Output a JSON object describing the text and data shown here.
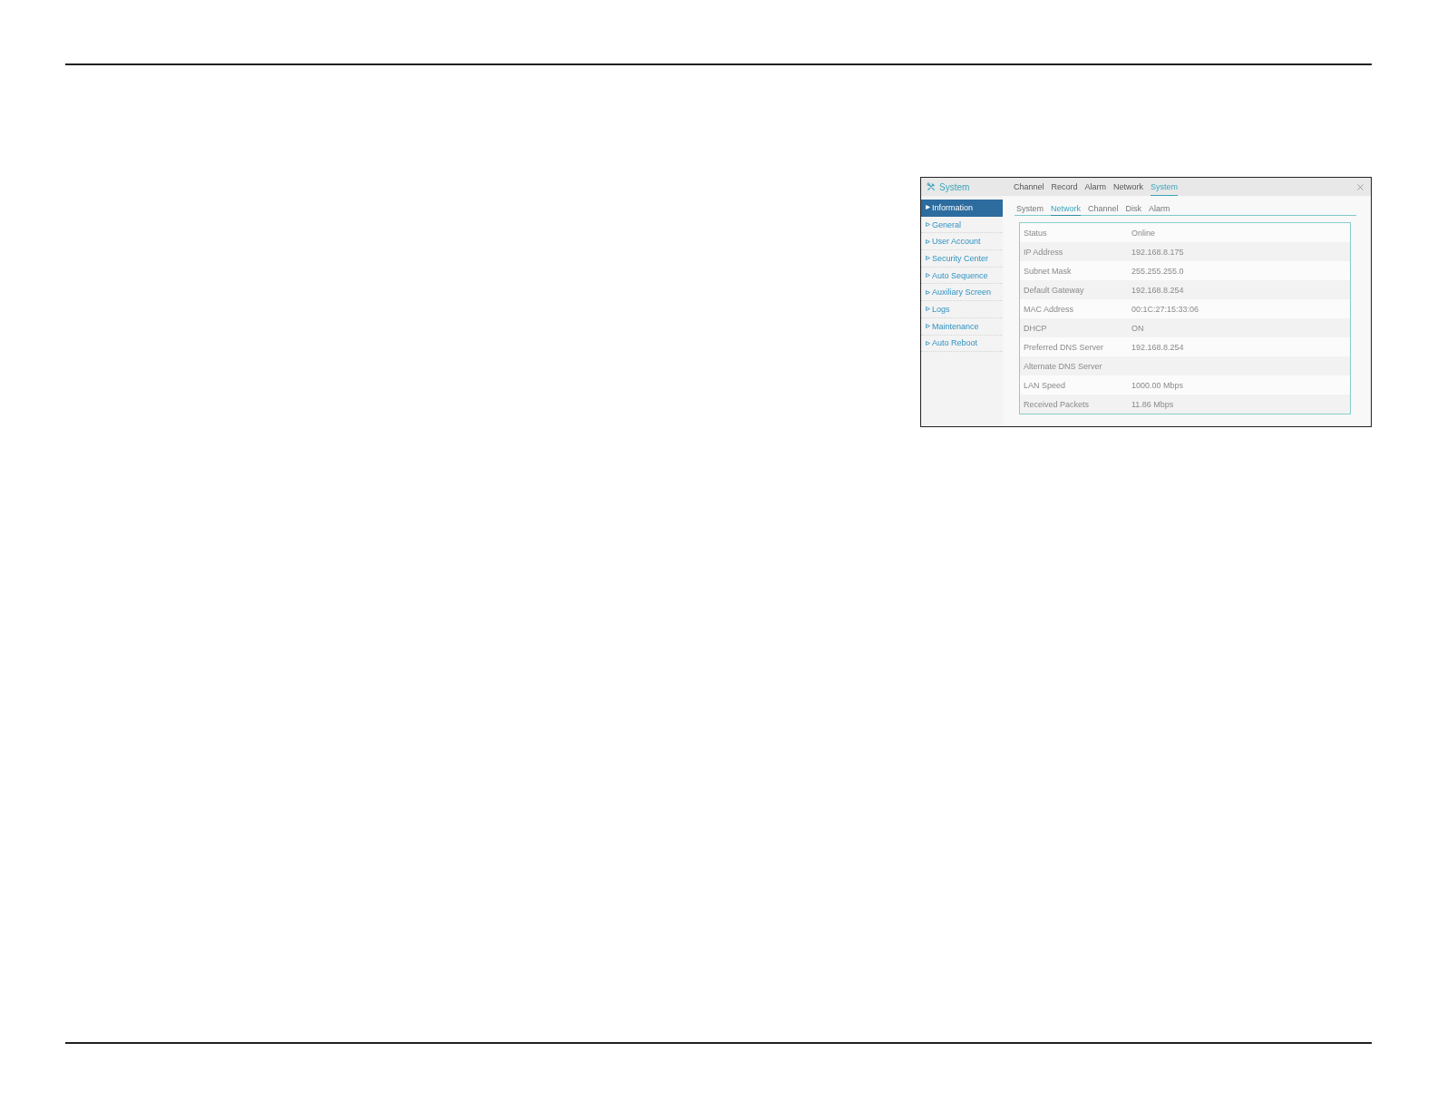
{
  "window": {
    "title": "System"
  },
  "main_tabs": [
    {
      "label": "Channel",
      "selected": false
    },
    {
      "label": "Record",
      "selected": false
    },
    {
      "label": "Alarm",
      "selected": false
    },
    {
      "label": "Network",
      "selected": false
    },
    {
      "label": "System",
      "selected": true
    }
  ],
  "sidebar": {
    "items": [
      {
        "label": "Information",
        "selected": true
      },
      {
        "label": "General",
        "selected": false
      },
      {
        "label": "User Account",
        "selected": false
      },
      {
        "label": "Security Center",
        "selected": false
      },
      {
        "label": "Auto Sequence",
        "selected": false
      },
      {
        "label": "Auxiliary Screen",
        "selected": false
      },
      {
        "label": "Logs",
        "selected": false
      },
      {
        "label": "Maintenance",
        "selected": false
      },
      {
        "label": "Auto Reboot",
        "selected": false
      }
    ]
  },
  "sub_tabs": [
    {
      "label": "System",
      "selected": false
    },
    {
      "label": "Network",
      "selected": true
    },
    {
      "label": "Channel",
      "selected": false
    },
    {
      "label": "Disk",
      "selected": false
    },
    {
      "label": "Alarm",
      "selected": false
    }
  ],
  "info_table": {
    "rows": [
      {
        "label": "Status",
        "value": "Online"
      },
      {
        "label": "IP Address",
        "value": "192.168.8.175"
      },
      {
        "label": "Subnet Mask",
        "value": "255.255.255.0"
      },
      {
        "label": "Default Gateway",
        "value": "192.168.8.254"
      },
      {
        "label": "MAC Address",
        "value": "00:1C:27:15:33:06"
      },
      {
        "label": "DHCP",
        "value": "ON"
      },
      {
        "label": "Preferred DNS Server",
        "value": "192.168.8.254"
      },
      {
        "label": "Alternate DNS Server"
      },
      {
        "label": "LAN Speed",
        "value": "1000.00 Mbps"
      },
      {
        "label": "Received Packets",
        "value": "11.86 Mbps"
      }
    ]
  }
}
